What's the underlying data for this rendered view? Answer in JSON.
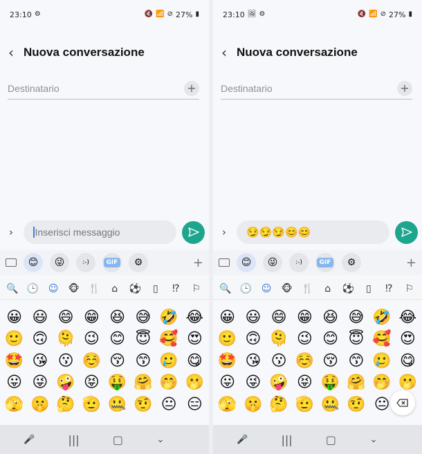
{
  "phones": [
    {
      "status": {
        "time": "23:10",
        "left_icons": [
          "gear-icon"
        ],
        "battery": "27%"
      },
      "header": {
        "title": "Nuova conversazione"
      },
      "recipient": {
        "placeholder": "Destinatario"
      },
      "composer": {
        "text": "Inserisci messaggio",
        "has_emojis": false
      }
    },
    {
      "status": {
        "time": "23:10",
        "left_icons": [
          "image-icon",
          "gear-icon"
        ],
        "battery": "27%"
      },
      "header": {
        "title": "Nuova conversazione"
      },
      "recipient": {
        "placeholder": "Destinatario"
      },
      "composer": {
        "text": "😏😏😏😊😊",
        "has_emojis": true
      }
    }
  ],
  "keyboard": {
    "top_buttons": [
      "keyboard-icon",
      "emoji-icon",
      "sticker-icon",
      "emoticon-icon",
      "gif-icon",
      "settings-icon",
      "plus-icon"
    ],
    "gif_label": "GIF",
    "emoticon_label": ":-)",
    "categories": [
      "search-icon",
      "recent-icon",
      "smileys-icon",
      "animals-icon",
      "food-icon",
      "places-icon",
      "activities-icon",
      "objects-icon",
      "symbols-icon",
      "flags-icon"
    ]
  },
  "emoji_rows": [
    [
      "😀",
      "😃",
      "😄",
      "😁",
      "😆",
      "😅",
      "🤣",
      "😂"
    ],
    [
      "🙂",
      "🙃",
      "🫠",
      "😉",
      "😊",
      "😇",
      "🥰",
      "😍"
    ],
    [
      "🤩",
      "😘",
      "😗",
      "☺️",
      "😚",
      "😙",
      "🥲",
      "😋"
    ],
    [
      "😛",
      "😜",
      "🤪",
      "😝",
      "🤑",
      "🤗",
      "🤭",
      "🫢"
    ],
    [
      "🫣",
      "🤫",
      "🤔",
      "🫡",
      "🤐",
      "🤨",
      "😐",
      "😑"
    ]
  ]
}
